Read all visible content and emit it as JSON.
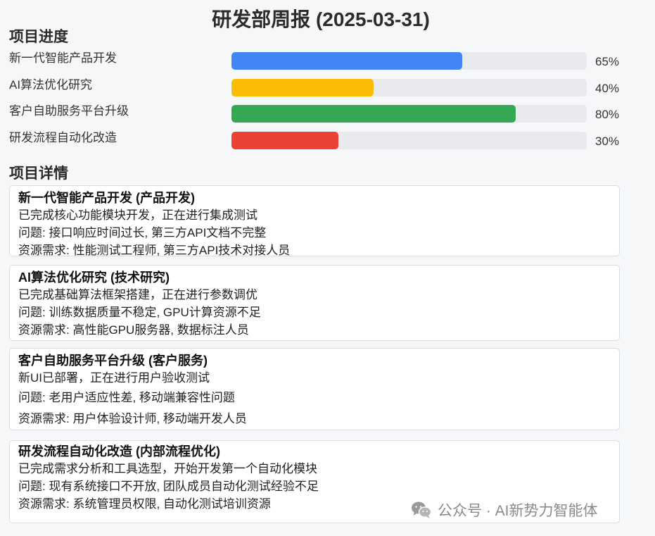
{
  "title": "研发部周报 (2025-03-31)",
  "progress_section_title": "项目进度",
  "details_section_title": "项目详情",
  "progress": [
    {
      "name": "新一代智能产品开发",
      "percent": 65,
      "label": "65%",
      "color": "#4285f4"
    },
    {
      "name": "AI算法优化研究",
      "percent": 40,
      "label": "40%",
      "color": "#fbbc05"
    },
    {
      "name": "客户自助服务平台升级",
      "percent": 80,
      "label": "80%",
      "color": "#34a853"
    },
    {
      "name": "研发流程自动化改造",
      "percent": 30,
      "label": "30%",
      "color": "#ea4335"
    }
  ],
  "projects": [
    {
      "heading": "新一代智能产品开发 (产品开发)",
      "status": "已完成核心功能模块开发，正在进行集成测试",
      "issues": "问题: 接口响应时间过长, 第三方API文档不完整",
      "resources": "资源需求: 性能测试工程师, 第三方API技术对接人员"
    },
    {
      "heading": "AI算法优化研究 (技术研究)",
      "status": "已完成基础算法框架搭建，正在进行参数调优",
      "issues": "问题: 训练数据质量不稳定, GPU计算资源不足",
      "resources": "资源需求: 高性能GPU服务器, 数据标注人员"
    },
    {
      "heading": "客户自助服务平台升级 (客户服务)",
      "status": "新UI已部署，正在进行用户验收测试",
      "issues": "问题: 老用户适应性差, 移动端兼容性问题",
      "resources": "资源需求: 用户体验设计师, 移动端开发人员"
    },
    {
      "heading": "研发流程自动化改造 (内部流程优化)",
      "status": "已完成需求分析和工具选型，开始开发第一个自动化模块",
      "issues": "问题: 现有系统接口不开放, 团队成员自动化测试经验不足",
      "resources": "资源需求: 系统管理员权限, 自动化测试培训资源"
    }
  ],
  "watermark": "公众号 · AI新势力智能体",
  "watermark_icon": "wechat-icon"
}
